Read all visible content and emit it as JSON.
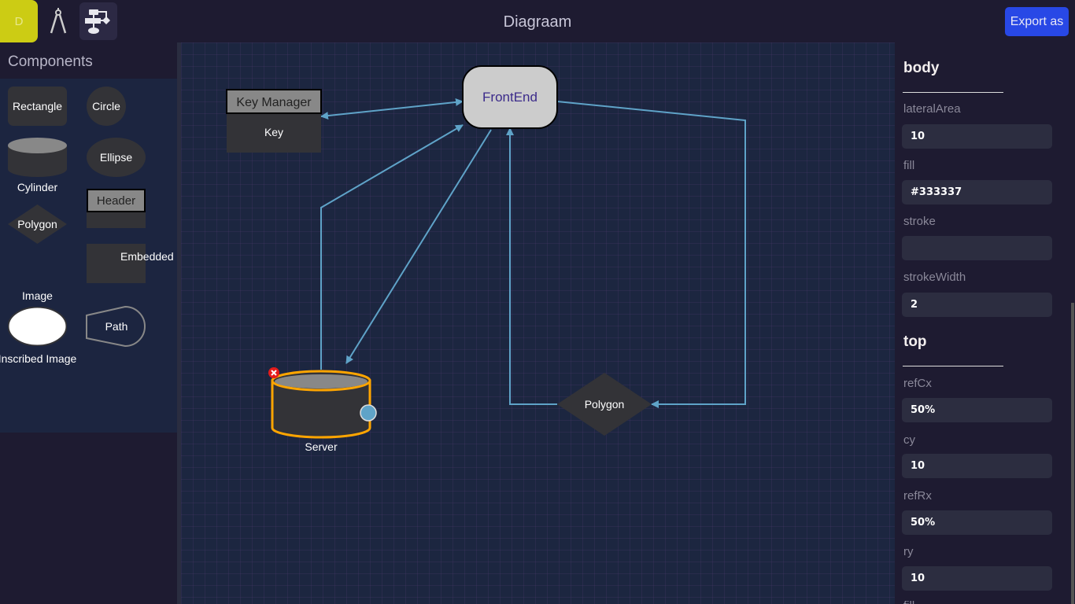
{
  "app": {
    "logo_letter": "D",
    "title": "Diagraam",
    "export_label": "Export as"
  },
  "toolbar": {
    "tools": [
      {
        "icon": "compass-icon"
      },
      {
        "icon": "flowchart-icon",
        "active": true
      }
    ]
  },
  "components": {
    "heading": "Components",
    "items": [
      "Rectangle",
      "Circle",
      "Cylinder",
      "Ellipse",
      "Header",
      "Polygon",
      "Embedded I",
      "Image",
      "Path",
      "Inscribed Image"
    ]
  },
  "canvas": {
    "nodes": {
      "key_manager_header": "Key Manager",
      "key_manager_body": "Key",
      "frontend": "FrontEnd",
      "server": "Server",
      "polygon": "Polygon"
    },
    "colors": {
      "edge": "#5fa3c8",
      "selection": "#ffa500",
      "node_fill": "#333337",
      "frontend_fill": "#cccccc"
    }
  },
  "properties": {
    "sections": [
      {
        "title": "body",
        "fields": [
          {
            "label": "lateralArea",
            "value": "10"
          },
          {
            "label": "fill",
            "value": "#333337"
          },
          {
            "label": "stroke",
            "value": ""
          },
          {
            "label": "strokeWidth",
            "value": "2"
          }
        ]
      },
      {
        "title": "top",
        "fields": [
          {
            "label": "refCx",
            "value": "50%"
          },
          {
            "label": "cy",
            "value": "10"
          },
          {
            "label": "refRx",
            "value": "50%"
          },
          {
            "label": "ry",
            "value": "10"
          },
          {
            "label": "fill",
            "value": ""
          }
        ]
      }
    ]
  }
}
